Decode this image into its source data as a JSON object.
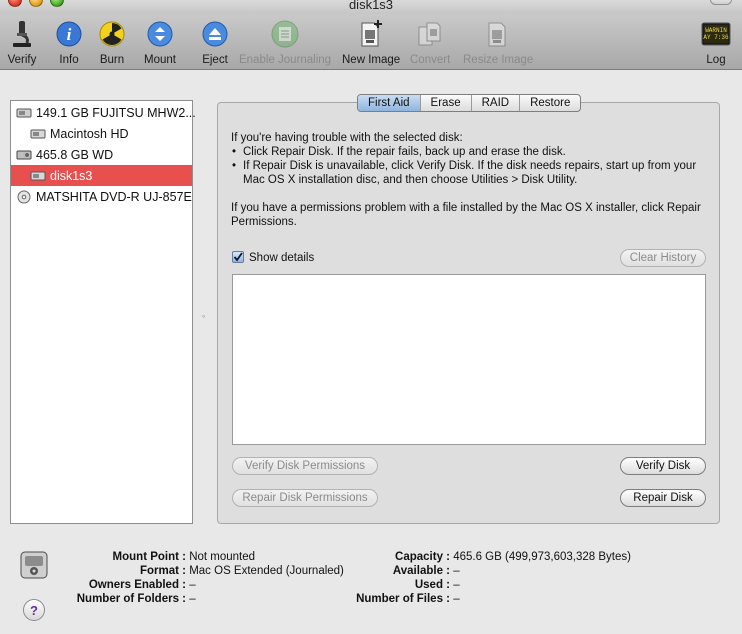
{
  "window": {
    "title": "disk1s3"
  },
  "toolbar": {
    "items": [
      {
        "label": "Verify",
        "icon": "microscope-icon",
        "enabled": true
      },
      {
        "label": "Info",
        "icon": "info-icon",
        "enabled": true
      },
      {
        "label": "Burn",
        "icon": "burn-icon",
        "enabled": true
      },
      {
        "label": "Mount",
        "icon": "mount-icon",
        "enabled": true
      },
      {
        "label": "Eject",
        "icon": "eject-icon",
        "enabled": true
      },
      {
        "label": "Enable Journaling",
        "icon": "journal-icon",
        "enabled": false
      },
      {
        "label": "New Image",
        "icon": "new-image-icon",
        "enabled": true
      },
      {
        "label": "Convert",
        "icon": "convert-icon",
        "enabled": false
      },
      {
        "label": "Resize Image",
        "icon": "resize-image-icon",
        "enabled": false
      },
      {
        "label": "Log",
        "icon": "log-icon",
        "enabled": true,
        "badge": "WARNIN\nAY 7:36"
      }
    ]
  },
  "sidebar": {
    "items": [
      {
        "label": "149.1 GB FUJITSU MHW2...",
        "icon": "hard-drive-icon",
        "level": 0,
        "selected": false
      },
      {
        "label": "Macintosh HD",
        "icon": "volume-icon",
        "level": 1,
        "selected": false
      },
      {
        "label": "465.8 GB WD",
        "icon": "external-drive-icon",
        "level": 0,
        "selected": false
      },
      {
        "label": "disk1s3",
        "icon": "volume-icon",
        "level": 1,
        "selected": true
      },
      {
        "label": "MATSHITA DVD-R UJ-857E",
        "icon": "optical-drive-icon",
        "level": 0,
        "selected": false
      }
    ]
  },
  "tabs": [
    {
      "label": "First Aid",
      "active": true
    },
    {
      "label": "Erase",
      "active": false
    },
    {
      "label": "RAID",
      "active": false
    },
    {
      "label": "Restore",
      "active": false
    }
  ],
  "first_aid": {
    "intro": "If you're having trouble with the selected disk:",
    "bullet1": "Click Repair Disk. If the repair fails, back up and erase the disk.",
    "bullet2": "If Repair Disk is unavailable, click Verify Disk. If the disk needs repairs, start up from your Mac OS X installation disc, and then choose Utilities > Disk Utility.",
    "permissions_text": "If you have a permissions problem with a file installed by the Mac OS X installer, click Repair Permissions.",
    "show_details_label": "Show details",
    "show_details_checked": true,
    "clear_history_label": "Clear History",
    "verify_permissions_label": "Verify Disk Permissions",
    "repair_permissions_label": "Repair Disk Permissions",
    "verify_disk_label": "Verify Disk",
    "repair_disk_label": "Repair Disk"
  },
  "disk_info": {
    "mount_point_key": "Mount Point :",
    "mount_point_val": "Not mounted",
    "format_key": "Format :",
    "format_val": "Mac OS Extended (Journaled)",
    "owners_key": "Owners Enabled :",
    "owners_val": "–",
    "folders_key": "Number of Folders :",
    "folders_val": "–",
    "capacity_key": "Capacity :",
    "capacity_val": "465.6 GB (499,973,603,328 Bytes)",
    "available_key": "Available :",
    "available_val": "–",
    "used_key": "Used :",
    "used_val": "–",
    "files_key": "Number of Files :",
    "files_val": "–"
  },
  "help": {
    "label": "?"
  },
  "colors": {
    "selection": "#e8504f",
    "tab_active": "#9fc0e4"
  }
}
